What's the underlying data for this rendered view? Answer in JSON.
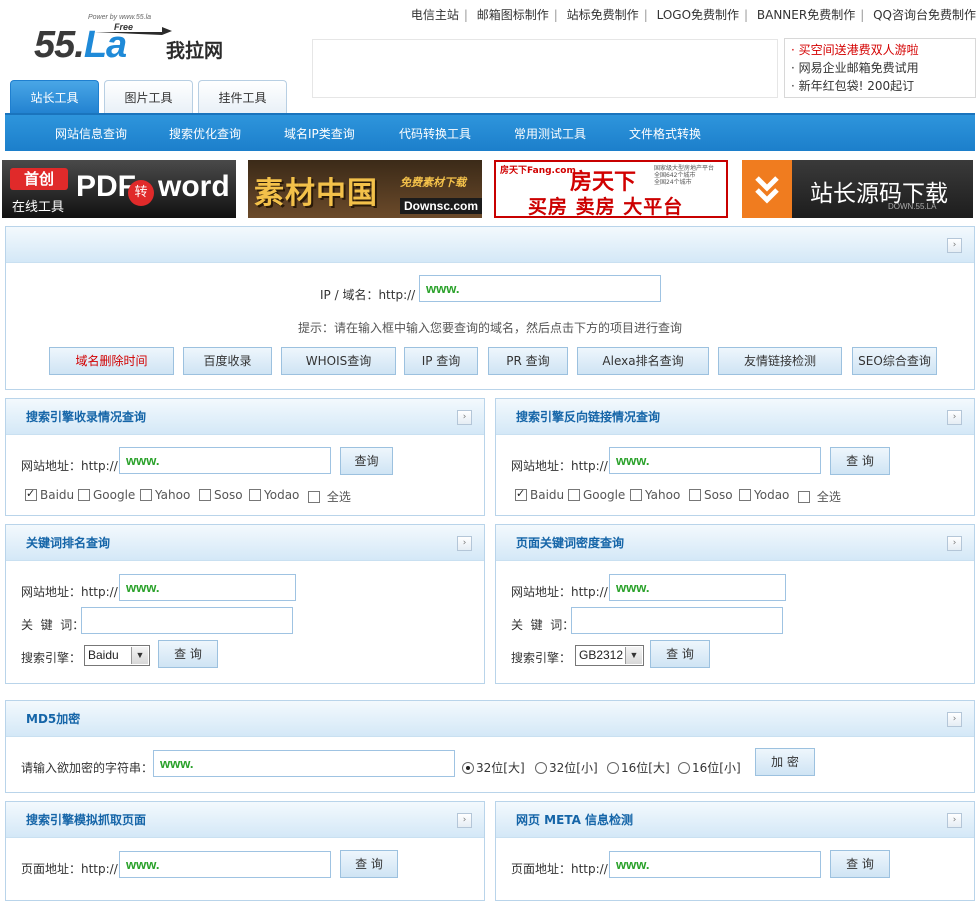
{
  "header": {
    "logo": {
      "number": "55.",
      "la": "La",
      "cn": "我拉网",
      "power": "Power by www.55.la",
      "free": "Free"
    },
    "top_links": [
      "电信主站",
      "邮箱图标制作",
      "站标免费制作",
      "LOGO免费制作",
      "BANNER免费制作",
      "QQ咨询台免费制作"
    ],
    "ad_lines": [
      "· 买空间送港费双人游啦",
      "· 网易企业邮箱免费试用",
      "· 新年红包袋! 200起订"
    ]
  },
  "tabs": [
    "站长工具",
    "图片工具",
    "挂件工具"
  ],
  "nav": [
    "网站信息查询",
    "搜索优化查询",
    "域名IP类查询",
    "代码转换工具",
    "常用测试工具",
    "文件格式转换"
  ],
  "banners": {
    "b1": {
      "tag1": "首创",
      "tag2": "在线工具",
      "pdf": "PDF",
      "zhuan": "转",
      "word": "word"
    },
    "b2": {
      "main": "素材中国",
      "sub": "免费素材下载",
      "url": "Downsc.com"
    },
    "b3": {
      "brand": "房天下",
      "brand_small": "房天下Fang.com",
      "line": "买房 卖房 大平台",
      "note1": "国家级大型房地产平台",
      "note2": "全国642个城市",
      "note3": "全国24个城市"
    },
    "b4": {
      "main": "站长源码下载",
      "url": "DOWN.55.LA"
    }
  },
  "main_query": {
    "label": "IP / 域名：http://",
    "value": "www.",
    "hint": "提示：请在输入框中输入您要查询的域名，然后点击下方的项目进行查询",
    "buttons": [
      "域名删除时间",
      "百度收录",
      "WHOIS查询",
      "IP 查询",
      "PR 查询",
      "Alexa排名查询",
      "友情链接检测",
      "SEO综合查询"
    ]
  },
  "panels": {
    "index": {
      "title": "搜索引擎收录情况查询",
      "label": "网站地址：http://",
      "value": "www.",
      "button": "查询",
      "engines": [
        "Baidu",
        "Google",
        "Yahoo",
        "Soso",
        "Yodao",
        "全选"
      ]
    },
    "backlink": {
      "title": "搜索引擎反向链接情况查询",
      "label": "网站地址：http://",
      "value": "www.",
      "button": "查 询",
      "engines": [
        "Baidu",
        "Google",
        "Yahoo",
        "Soso",
        "Yodao",
        "全选"
      ]
    },
    "rank": {
      "title": "关键词排名查询",
      "label": "网站地址：http://",
      "value": "www.",
      "kw_label": "关  键  词：",
      "engine_label": "搜索引擎：",
      "engine": "Baidu",
      "button": "查 询"
    },
    "density": {
      "title": "页面关键词密度查询",
      "label": "网站地址：http://",
      "value": "www.",
      "kw_label": "关  键  词：",
      "engine_label": "搜索引擎：",
      "encoding": "GB2312",
      "button": "查 询"
    },
    "md5": {
      "title": "MD5加密",
      "label": "请输入欲加密的字符串：",
      "value": "www.",
      "options": [
        "32位[大]",
        "32位[小]",
        "16位[大]",
        "16位[小]"
      ],
      "button": "加 密"
    },
    "spider": {
      "title": "搜索引擎模拟抓取页面",
      "label": "页面地址：http://",
      "value": "www.",
      "button": "查 询"
    },
    "meta": {
      "title": "网页 META 信息检测",
      "label": "页面地址：http://",
      "value": "www.",
      "button": "查 询"
    }
  }
}
